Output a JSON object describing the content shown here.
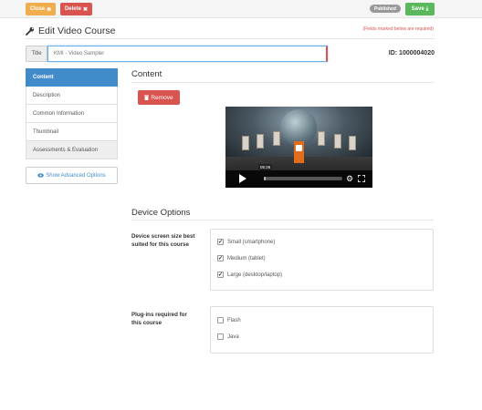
{
  "toolbar": {
    "close_label": "Close",
    "close_icon": "⊗",
    "delete_label": "Delete",
    "delete_icon": "✖",
    "status_badge": "Published",
    "save_label": "Save",
    "save_icon": "⤓"
  },
  "header": {
    "title": "Edit Video Course",
    "required_note": "(Fields marked below are required)"
  },
  "title_field": {
    "label": "Title",
    "value": "KMI - Video Sampler"
  },
  "course_id": "ID: 1000004020",
  "sidebar": {
    "items": [
      {
        "label": "Content",
        "active": true
      },
      {
        "label": "Description",
        "active": false
      },
      {
        "label": "Common Information",
        "active": false
      },
      {
        "label": "Thumbnail",
        "active": false
      },
      {
        "label": "Assessments & Evaluation",
        "active": false
      }
    ],
    "advanced_label": "Show Advanced Options"
  },
  "content": {
    "title": "Content",
    "remove_label": "Remove",
    "video": {
      "time_tooltip": "05:26",
      "progress": 0.02
    }
  },
  "device_options": {
    "title": "Device Options",
    "screen_label": "Device screen size best suited for this course",
    "screens": [
      {
        "label": "Small (smartphone)",
        "checked": true
      },
      {
        "label": "Medium (tablet)",
        "checked": true
      },
      {
        "label": "Large (desktop/laptop)",
        "checked": true
      }
    ],
    "plugins_label": "Plug-ins required for this course",
    "plugins": [
      {
        "label": "Flash",
        "checked": false
      },
      {
        "label": "Java",
        "checked": false
      }
    ]
  },
  "colors": {
    "warning": "#f0ad4e",
    "danger": "#d9534f",
    "success": "#5cb85c",
    "primary": "#428bca"
  }
}
